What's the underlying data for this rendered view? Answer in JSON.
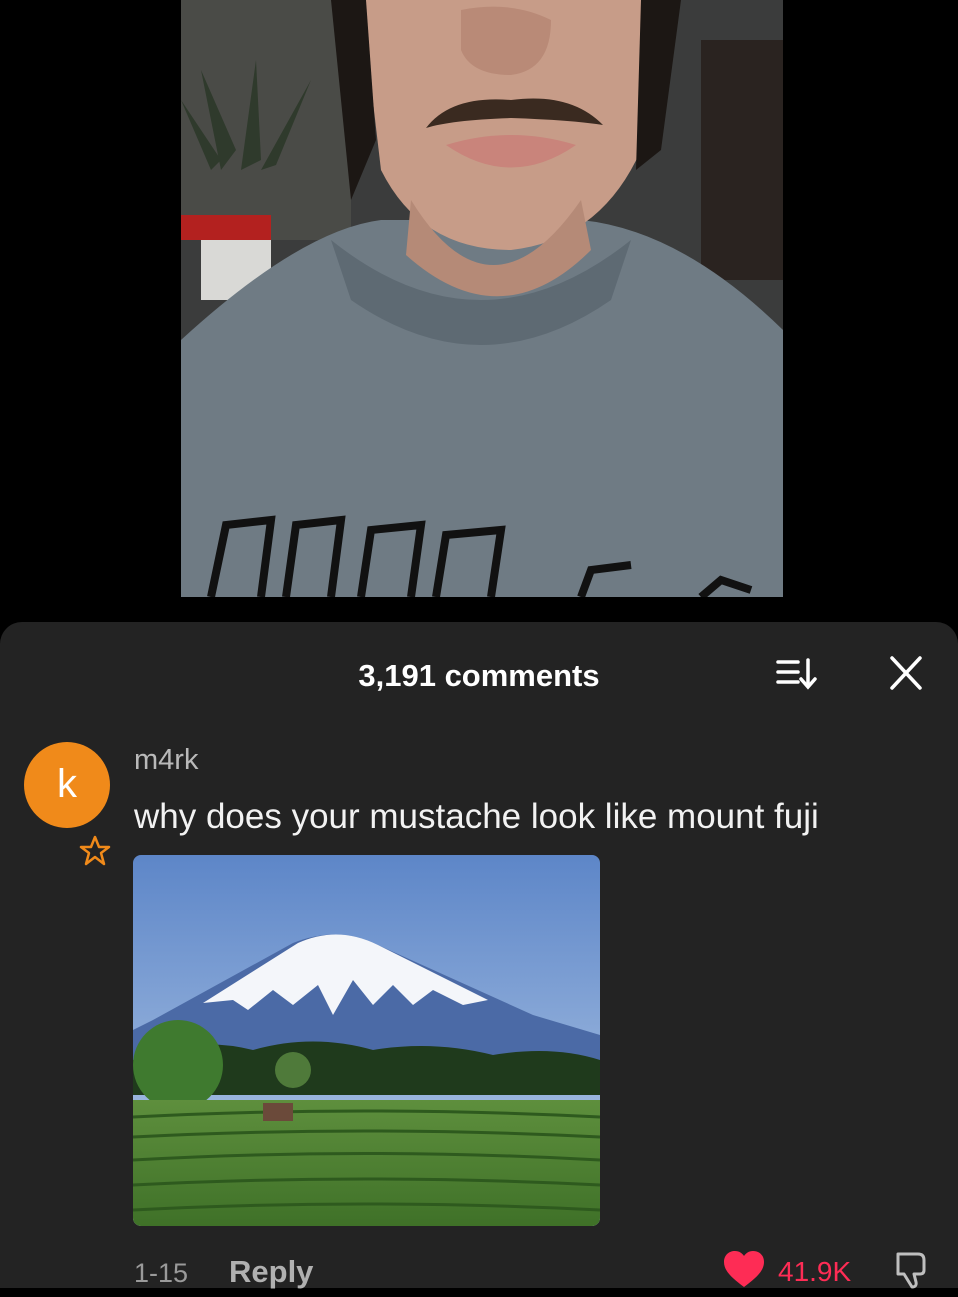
{
  "comments_panel": {
    "count_label": "3,191 comments",
    "sort_icon": "sort-icon",
    "close_icon": "close-icon"
  },
  "comment": {
    "avatar_letter": "k",
    "avatar_color": "#f08a1a",
    "username": "m4rk",
    "text": "why does your mustache look like mount fuji",
    "date": "1-15",
    "reply_label": "Reply",
    "like_count": "41.9K",
    "like_color": "#fe2c55",
    "liked": true
  }
}
